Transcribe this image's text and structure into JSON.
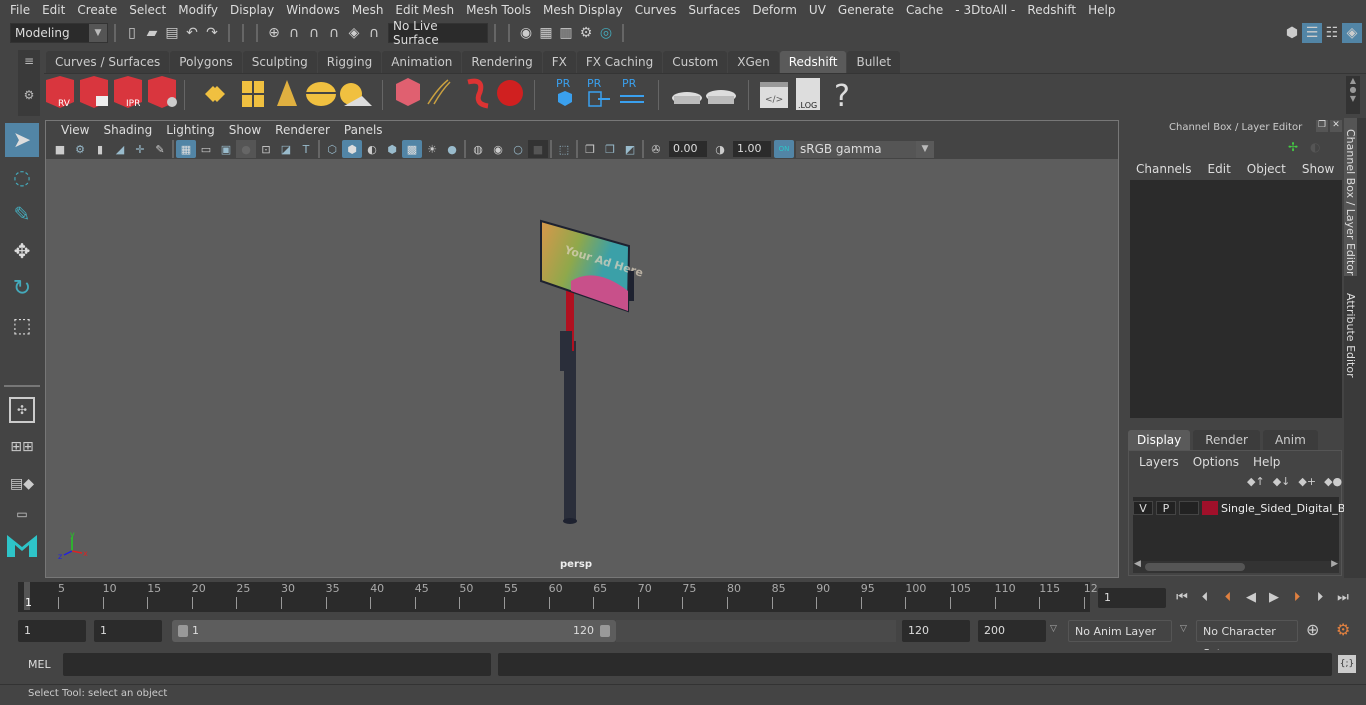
{
  "menubar": {
    "items": [
      "File",
      "Edit",
      "Create",
      "Select",
      "Modify",
      "Display",
      "Windows",
      "Mesh",
      "Edit Mesh",
      "Mesh Tools",
      "Mesh Display",
      "Curves",
      "Surfaces",
      "Deform",
      "UV",
      "Generate",
      "Cache",
      "- 3DtoAll -",
      "Redshift",
      "Help"
    ]
  },
  "statusline": {
    "mode": "Modeling",
    "live_surface": "No Live Surface"
  },
  "shelf": {
    "tabs": [
      "Curves / Surfaces",
      "Polygons",
      "Sculpting",
      "Rigging",
      "Animation",
      "Rendering",
      "FX",
      "FX Caching",
      "Custom",
      "XGen",
      "Redshift",
      "Bullet"
    ],
    "active_tab": "Redshift",
    "icon_labels": {
      "rv": "RV",
      "ipr": "IPR",
      "pr": "PR",
      "log": ".LOG",
      "help": "?"
    }
  },
  "viewport": {
    "menu": [
      "View",
      "Shading",
      "Lighting",
      "Show",
      "Renderer",
      "Panels"
    ],
    "exposure": "0.00",
    "gamma": "1.00",
    "color_space": "sRGB gamma",
    "on_label": "ON",
    "camera_label": "persp",
    "billboard_text": "Your Ad Here",
    "axis": {
      "x": "x",
      "y": "y",
      "z": "z"
    }
  },
  "channel_box": {
    "title": "Channel Box / Layer Editor",
    "menu": [
      "Channels",
      "Edit",
      "Object",
      "Show"
    ],
    "layer_tabs": [
      "Display",
      "Render",
      "Anim"
    ],
    "active_layer_tab": "Display",
    "layer_menu": [
      "Layers",
      "Options",
      "Help"
    ],
    "layer": {
      "v": "V",
      "p": "P",
      "name": "Single_Sided_Digital_B",
      "color": "#a0102a"
    }
  },
  "side_tabs": [
    "Channel Box / Layer Editor",
    "Attribute Editor"
  ],
  "timeline": {
    "ticks": [
      "5",
      "10",
      "15",
      "20",
      "25",
      "30",
      "35",
      "40",
      "45",
      "50",
      "55",
      "60",
      "65",
      "70",
      "75",
      "80",
      "85",
      "90",
      "95",
      "100",
      "105",
      "110",
      "115",
      "12"
    ],
    "current_frame_marker": "1",
    "current_frame": "1"
  },
  "range": {
    "start": "1",
    "playback_start": "1",
    "slider_start": "1",
    "slider_end": "120",
    "playback_end": "120",
    "end": "200",
    "anim_layer": "No Anim Layer",
    "character_set": "No Character Set"
  },
  "command_line": {
    "label": "MEL"
  },
  "help_line": {
    "text": "Select Tool: select an object"
  }
}
